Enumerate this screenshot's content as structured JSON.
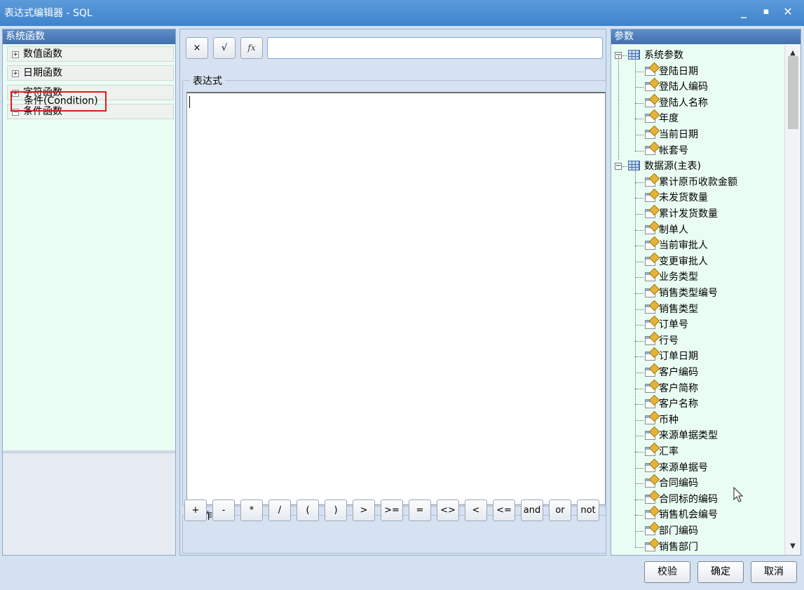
{
  "window": {
    "title": "表达式编辑器 - SQL",
    "minimize": "_",
    "maximize": "□",
    "close": "✕"
  },
  "left_panel": {
    "header": "系统函数",
    "categories": [
      {
        "toggle": "+",
        "label": "数值函数"
      },
      {
        "toggle": "+",
        "label": "日期函数"
      },
      {
        "toggle": "+",
        "label": "字符函数"
      },
      {
        "toggle": "−",
        "label": "条件函数"
      }
    ],
    "selected_item": "条件(Condition)"
  },
  "toolbar": {
    "clear": "×",
    "check": "√",
    "fx": "fx",
    "input_value": ""
  },
  "expression": {
    "legend": "表达式",
    "value": ""
  },
  "operators": {
    "legend": "操作符",
    "items": [
      "+",
      "-",
      "*",
      "/",
      "(",
      ")",
      ">",
      ">=",
      "=",
      "<>",
      "<",
      "<=",
      "and",
      "or",
      "not"
    ]
  },
  "right_panel": {
    "header": "参数",
    "groups": [
      {
        "label": "系统参数",
        "items": [
          "登陆日期",
          "登陆人编码",
          "登陆人名称",
          "年度",
          "当前日期",
          "帐套号"
        ]
      },
      {
        "label": "数据源(主表)",
        "items": [
          "累计原币收款金额",
          "未发货数量",
          "累计发货数量",
          "制单人",
          "当前审批人",
          "变更审批人",
          "业务类型",
          "销售类型编号",
          "销售类型",
          "订单号",
          "行号",
          "订单日期",
          "客户编码",
          "客户简称",
          "客户名称",
          "币种",
          "来源单据类型",
          "汇率",
          "来源单据号",
          "合同编码",
          "合同标的编码",
          "销售机会编号",
          "部门编码",
          "销售部门"
        ]
      }
    ]
  },
  "buttons": {
    "verify": "校验",
    "ok": "确定",
    "cancel": "取消"
  }
}
